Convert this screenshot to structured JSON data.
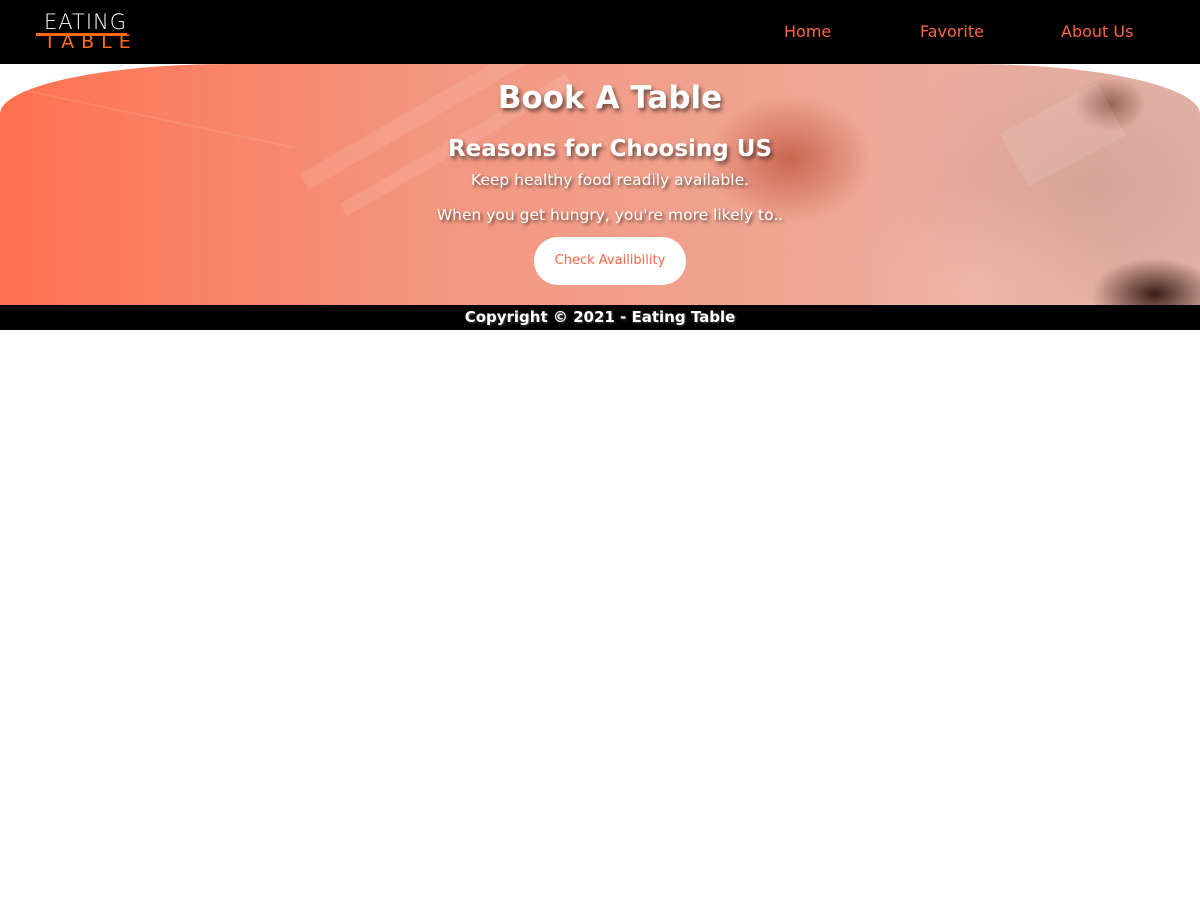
{
  "navbar": {
    "logo": {
      "line1": "EATING",
      "line2": "TABLE"
    },
    "links": [
      {
        "label": "Home"
      },
      {
        "label": "Favorite"
      },
      {
        "label": "About Us"
      }
    ]
  },
  "hero": {
    "title": "Book A Table",
    "subtitle": "Reasons for Choosing US",
    "line1": "Keep healthy food readily available.",
    "line2": "When you get hungry, you're more likely to..",
    "button_label": "Check Availibility"
  },
  "footer": {
    "text": "Copyright © 2021 - Eating Table"
  },
  "colors": {
    "accent": "#ff6347",
    "logo_orange": "#ff6a13",
    "navbar_bg": "#000000",
    "footer_bg": "#000000"
  }
}
